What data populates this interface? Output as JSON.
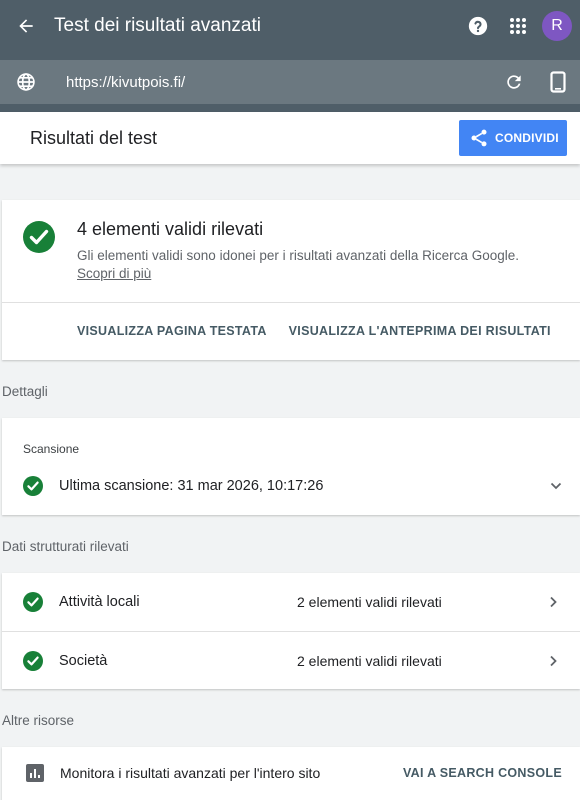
{
  "appbar": {
    "title": "Test dei risultati avanzati",
    "avatar_letter": "R"
  },
  "urlbar": {
    "url": "https://kivutpois.fi/"
  },
  "results_header": {
    "title": "Risultati del test",
    "share_label": "CONDIVIDI"
  },
  "summary": {
    "title": "4 elementi validi rilevati",
    "description": "Gli elementi validi sono idonei per i risultati avanzati della Ricerca Google.",
    "learn_more": "Scopri di più",
    "actions": [
      "VISUALIZZA PAGINA TESTATA",
      "VISUALIZZA L'ANTEPRIMA DEI RISULTATI"
    ]
  },
  "details": {
    "section_label": "Dettagli",
    "crawl_label": "Scansione",
    "last_crawl": "Ultima scansione: 31 mar 2026, 10:17:26"
  },
  "structured": {
    "section_label": "Dati strutturati rilevati",
    "items": [
      {
        "name": "Attività locali",
        "value": "2 elementi validi rilevati"
      },
      {
        "name": "Società",
        "value": "2 elementi validi rilevati"
      }
    ]
  },
  "resources": {
    "section_label": "Altre risorse",
    "monitor_text": "Monitora i risultati avanzati per l'intero sito",
    "console_link": "VAI A SEARCH CONSOLE"
  },
  "colors": {
    "appbar": "#4f5e68",
    "urlbar_field": "#6b7880",
    "accent": "#4285f4",
    "valid_green": "#188038",
    "avatar": "#7e57c2"
  }
}
